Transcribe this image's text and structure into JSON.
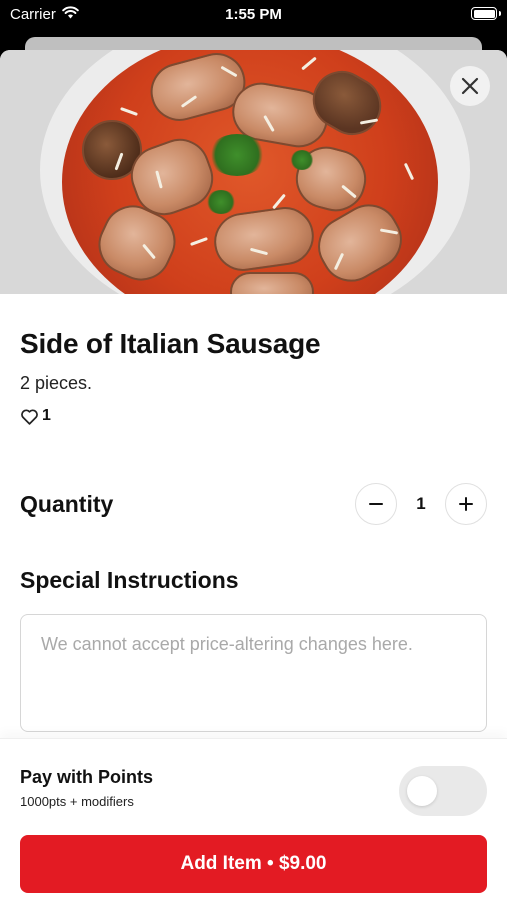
{
  "status_bar": {
    "carrier": "Carrier",
    "time": "1:55 PM",
    "wifi_icon": "wifi-icon",
    "battery_icon": "battery-icon"
  },
  "item": {
    "name": "Side of Italian Sausage",
    "description": "2 pieces.",
    "like_count": "1",
    "like_icon": "heart-outline-icon",
    "image_icon": "food-photo"
  },
  "quantity": {
    "label": "Quantity",
    "value": "1",
    "decrement_symbol": "−",
    "increment_symbol": "+"
  },
  "special_instructions": {
    "label": "Special Instructions",
    "placeholder": "We cannot accept price-altering changes here.",
    "value": ""
  },
  "points": {
    "title": "Pay with Points",
    "subtitle": "1000pts + modifiers",
    "enabled": false
  },
  "add_button": {
    "label": "Add Item • $9.00"
  },
  "colors": {
    "accent": "#e31b23",
    "toggle_off": "#e9e9e9"
  }
}
